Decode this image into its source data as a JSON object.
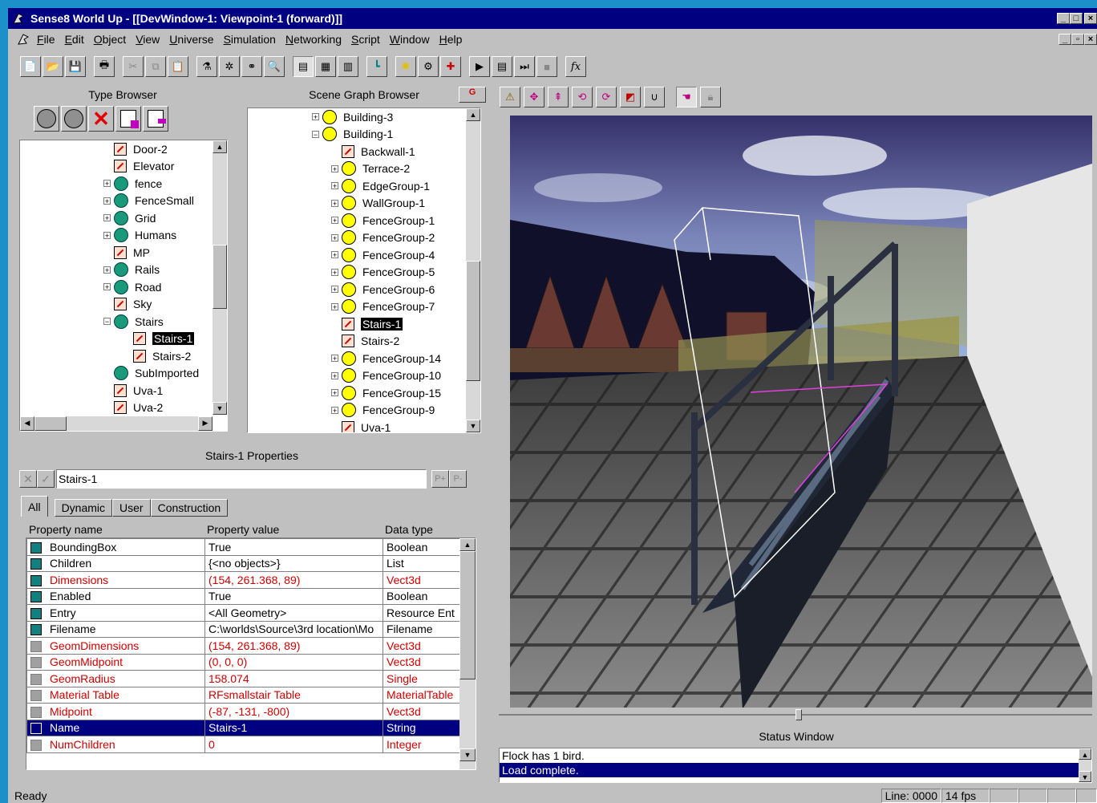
{
  "window": {
    "title": "Sense8 World Up - [[DevWindow-1: Viewpoint-1 (forward)]]"
  },
  "menu": [
    "File",
    "Edit",
    "Object",
    "View",
    "Universe",
    "Simulation",
    "Networking",
    "Script",
    "Window",
    "Help"
  ],
  "toolbar": {
    "fx_label": "fx"
  },
  "type_browser": {
    "title": "Type Browser",
    "items": [
      {
        "label": "Door-2",
        "icon": "object",
        "expander": "",
        "indent": 0
      },
      {
        "label": "Elevator",
        "icon": "object",
        "expander": "",
        "indent": 0
      },
      {
        "label": "fence",
        "icon": "type",
        "expander": "+",
        "indent": 0
      },
      {
        "label": "FenceSmall",
        "icon": "type",
        "expander": "+",
        "indent": 0
      },
      {
        "label": "Grid",
        "icon": "type",
        "expander": "+",
        "indent": 0
      },
      {
        "label": "Humans",
        "icon": "type",
        "expander": "+",
        "indent": 0
      },
      {
        "label": "MP",
        "icon": "object",
        "expander": "",
        "indent": 0
      },
      {
        "label": "Rails",
        "icon": "type",
        "expander": "+",
        "indent": 0
      },
      {
        "label": "Road",
        "icon": "type",
        "expander": "+",
        "indent": 0
      },
      {
        "label": "Sky",
        "icon": "object",
        "expander": "",
        "indent": 0
      },
      {
        "label": "Stairs",
        "icon": "type",
        "expander": "-",
        "indent": 0
      },
      {
        "label": "Stairs-1",
        "icon": "object",
        "expander": "",
        "indent": 1,
        "selected": true
      },
      {
        "label": "Stairs-2",
        "icon": "object",
        "expander": "",
        "indent": 1
      },
      {
        "label": "SubImported",
        "icon": "type",
        "expander": "",
        "indent": 0
      },
      {
        "label": "Uva-1",
        "icon": "object",
        "expander": "",
        "indent": 0
      },
      {
        "label": "Uva-2",
        "icon": "object",
        "expander": "",
        "indent": 0
      }
    ]
  },
  "scene_graph": {
    "title": "Scene Graph Browser",
    "items": [
      {
        "label": "Building-3",
        "icon": "group",
        "expander": "+",
        "indent": 0
      },
      {
        "label": "Building-1",
        "icon": "group",
        "expander": "-",
        "indent": 0
      },
      {
        "label": "Backwall-1",
        "icon": "object",
        "expander": "",
        "indent": 1
      },
      {
        "label": "Terrace-2",
        "icon": "group",
        "expander": "+",
        "indent": 1
      },
      {
        "label": "EdgeGroup-1",
        "icon": "group",
        "expander": "+",
        "indent": 1
      },
      {
        "label": "WallGroup-1",
        "icon": "group",
        "expander": "+",
        "indent": 1
      },
      {
        "label": "FenceGroup-1",
        "icon": "group",
        "expander": "+",
        "indent": 1
      },
      {
        "label": "FenceGroup-2",
        "icon": "group",
        "expander": "+",
        "indent": 1
      },
      {
        "label": "FenceGroup-4",
        "icon": "group",
        "expander": "+",
        "indent": 1
      },
      {
        "label": "FenceGroup-5",
        "icon": "group",
        "expander": "+",
        "indent": 1
      },
      {
        "label": "FenceGroup-6",
        "icon": "group",
        "expander": "+",
        "indent": 1
      },
      {
        "label": "FenceGroup-7",
        "icon": "group",
        "expander": "+",
        "indent": 1
      },
      {
        "label": "Stairs-1",
        "icon": "object",
        "expander": "",
        "indent": 1,
        "selected": true
      },
      {
        "label": "Stairs-2",
        "icon": "object",
        "expander": "",
        "indent": 1
      },
      {
        "label": "FenceGroup-14",
        "icon": "group",
        "expander": "+",
        "indent": 1
      },
      {
        "label": "FenceGroup-10",
        "icon": "group",
        "expander": "+",
        "indent": 1
      },
      {
        "label": "FenceGroup-15",
        "icon": "group",
        "expander": "+",
        "indent": 1
      },
      {
        "label": "FenceGroup-9",
        "icon": "group",
        "expander": "+",
        "indent": 1
      },
      {
        "label": "Uva-1",
        "icon": "object",
        "expander": "",
        "indent": 1
      }
    ]
  },
  "properties": {
    "title": "Stairs-1 Properties",
    "name_value": "Stairs-1",
    "tabs": [
      "All",
      "Dynamic",
      "User",
      "Construction"
    ],
    "columns": [
      "Property name",
      "Property value",
      "Data type"
    ],
    "rows": [
      {
        "name": "BoundingBox",
        "value": "True",
        "type": "Boolean",
        "red": false,
        "checked": true
      },
      {
        "name": "Children",
        "value": "{<no objects>}",
        "type": "List",
        "red": false,
        "checked": true
      },
      {
        "name": "Dimensions",
        "value": "(154, 261.368, 89)",
        "type": "Vect3d",
        "red": true,
        "checked": true
      },
      {
        "name": "Enabled",
        "value": "True",
        "type": "Boolean",
        "red": false,
        "checked": true
      },
      {
        "name": "Entry",
        "value": "<All Geometry>",
        "type": "Resource Ent",
        "red": false,
        "checked": true
      },
      {
        "name": "Filename",
        "value": "C:\\worlds\\Source\\3rd location\\Mo",
        "type": "Filename",
        "red": false,
        "checked": true
      },
      {
        "name": "GeomDimensions",
        "value": "(154, 261.368, 89)",
        "type": "Vect3d",
        "red": true,
        "checked": false
      },
      {
        "name": "GeomMidpoint",
        "value": "(0, 0, 0)",
        "type": "Vect3d",
        "red": true,
        "checked": false
      },
      {
        "name": "GeomRadius",
        "value": "158.074",
        "type": "Single",
        "red": true,
        "checked": false
      },
      {
        "name": "Material Table",
        "value": "RFsmallstair Table",
        "type": "MaterialTable",
        "red": true,
        "checked": false
      },
      {
        "name": "Midpoint",
        "value": "(-87, -131, -800)",
        "type": "Vect3d",
        "red": true,
        "checked": false
      },
      {
        "name": "Name",
        "value": "Stairs-1",
        "type": "String",
        "red": false,
        "checked": false,
        "selected": true
      },
      {
        "name": "NumChildren",
        "value": "0",
        "type": "Integer",
        "red": true,
        "checked": false
      }
    ]
  },
  "status_window": {
    "title": "Status Window",
    "lines": [
      "Flock has 1 bird.",
      "Load complete."
    ]
  },
  "statusbar": {
    "left": "Ready",
    "line": "Line: 0000",
    "fps": "14 fps"
  }
}
